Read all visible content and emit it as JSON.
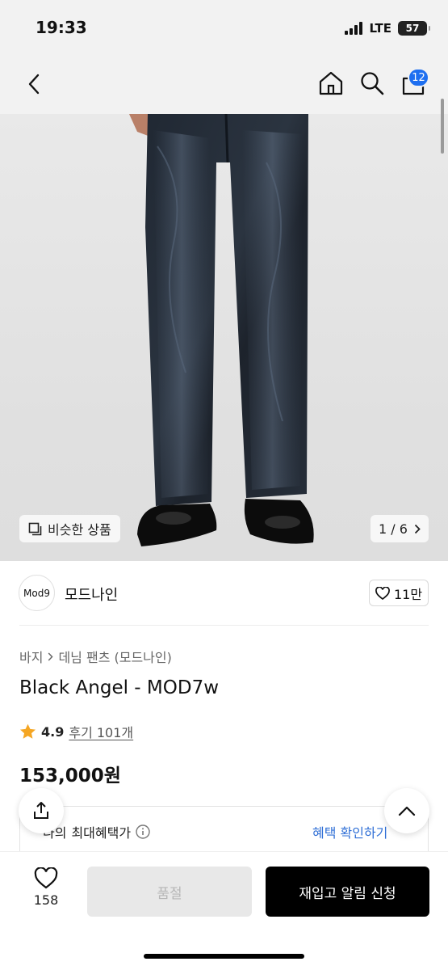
{
  "status_bar": {
    "time": "19:33",
    "network": "LTE",
    "battery": "57"
  },
  "nav": {
    "cart_count": "12"
  },
  "gallery": {
    "similar_label": "비슷한 상품",
    "page_indicator": "1 / 6"
  },
  "brand": {
    "logo_text": "Mod9",
    "name": "모드나인",
    "likes": "11만"
  },
  "breadcrumb": {
    "category": "바지",
    "subcategory": "데님 팬츠 (모드나인)"
  },
  "product": {
    "title": "Black Angel - MOD7w",
    "rating": "4.9",
    "reviews": "후기 101개",
    "price": "153,000원"
  },
  "benefit": {
    "label_prefix": "나의",
    "label": "최대혜택가",
    "link": "혜택 확인하기"
  },
  "bottom": {
    "wish_count": "158",
    "soldout_label": "품절",
    "restock_label": "재입고 알림 신청"
  },
  "colors": {
    "accent_blue": "#1e6ff0",
    "link_blue": "#2f6fd6",
    "star": "#f5a623"
  }
}
